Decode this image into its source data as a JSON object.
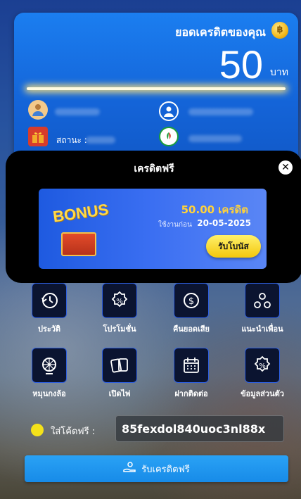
{
  "balance_card": {
    "title": "ยอดเครดิตของคุณ",
    "coin_symbol": "฿",
    "amount": "50",
    "unit": "บาท",
    "status_label": "สถานะ :"
  },
  "modal": {
    "title": "เครดิตฟรี",
    "close_symbol": "✕",
    "bonus": {
      "badge_text": "BONUS",
      "amount": "50.00 เครดิต",
      "expire_label": "ใช้งานก่อน",
      "expire_date": "20-05-2025",
      "claim_label": "รับโบนัส"
    }
  },
  "menu": {
    "items": [
      {
        "label": "ประวัติ",
        "icon": "history-icon"
      },
      {
        "label": "โปรโมชั่น",
        "icon": "promotion-icon"
      },
      {
        "label": "คืนยอดเสีย",
        "icon": "cashback-icon"
      },
      {
        "label": "แนะนำเพื่อน",
        "icon": "referral-icon"
      },
      {
        "label": "หมุนกงล้อ",
        "icon": "wheel-icon"
      },
      {
        "label": "เปิดไพ่",
        "icon": "cards-icon"
      },
      {
        "label": "ฝากติดต่อ",
        "icon": "calendar-icon"
      },
      {
        "label": "ข้อมูลส่วนตัว",
        "icon": "profile-icon"
      }
    ]
  },
  "promo": {
    "label": "ใส่โค้ดฟรี :",
    "code_value": "85fexdol840uoc3nl88x"
  },
  "redeem_button": {
    "label": "รับเครดิตฟรี"
  },
  "colors": {
    "card_blue": "#1464d8",
    "accent_yellow": "#f3c70c",
    "icon_border": "#2e5fe0",
    "button_blue": "#178be8"
  }
}
